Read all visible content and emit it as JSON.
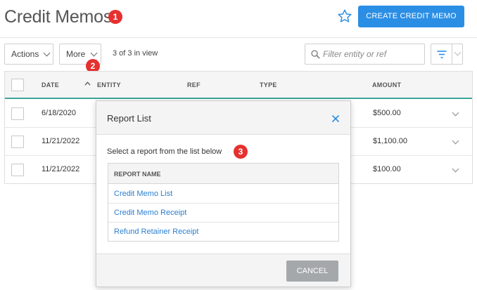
{
  "header": {
    "title": "Credit Memos",
    "create_label": "CREATE CREDIT MEMO",
    "accent": "#2b8ee5"
  },
  "badges": {
    "b1": "1",
    "b2": "2",
    "b3": "3",
    "color": "#e5312f"
  },
  "toolbar": {
    "actions_label": "Actions",
    "more_label": "More",
    "view_count": "3 of 3 in view",
    "filter_placeholder": "Filter entity or ref"
  },
  "table": {
    "columns": {
      "date": "DATE",
      "entity": "ENTITY",
      "ref": "REF",
      "type": "TYPE",
      "amount": "AMOUNT"
    },
    "rows": [
      {
        "date": "6/18/2020",
        "amount": "$500.00"
      },
      {
        "date": "11/21/2022",
        "amount": "$1,100.00"
      },
      {
        "date": "11/21/2022",
        "amount": "$100.00"
      }
    ]
  },
  "modal": {
    "title": "Report List",
    "instruction": "Select a report from the list below",
    "column": "REPORT NAME",
    "reports": [
      "Credit Memo List",
      "Credit Memo Receipt",
      "Refund Retainer Receipt"
    ],
    "cancel_label": "CANCEL"
  },
  "icons": [
    "star-icon",
    "search-icon",
    "filter-icon",
    "close-icon",
    "chevron-down-icon",
    "sort-up-icon"
  ]
}
